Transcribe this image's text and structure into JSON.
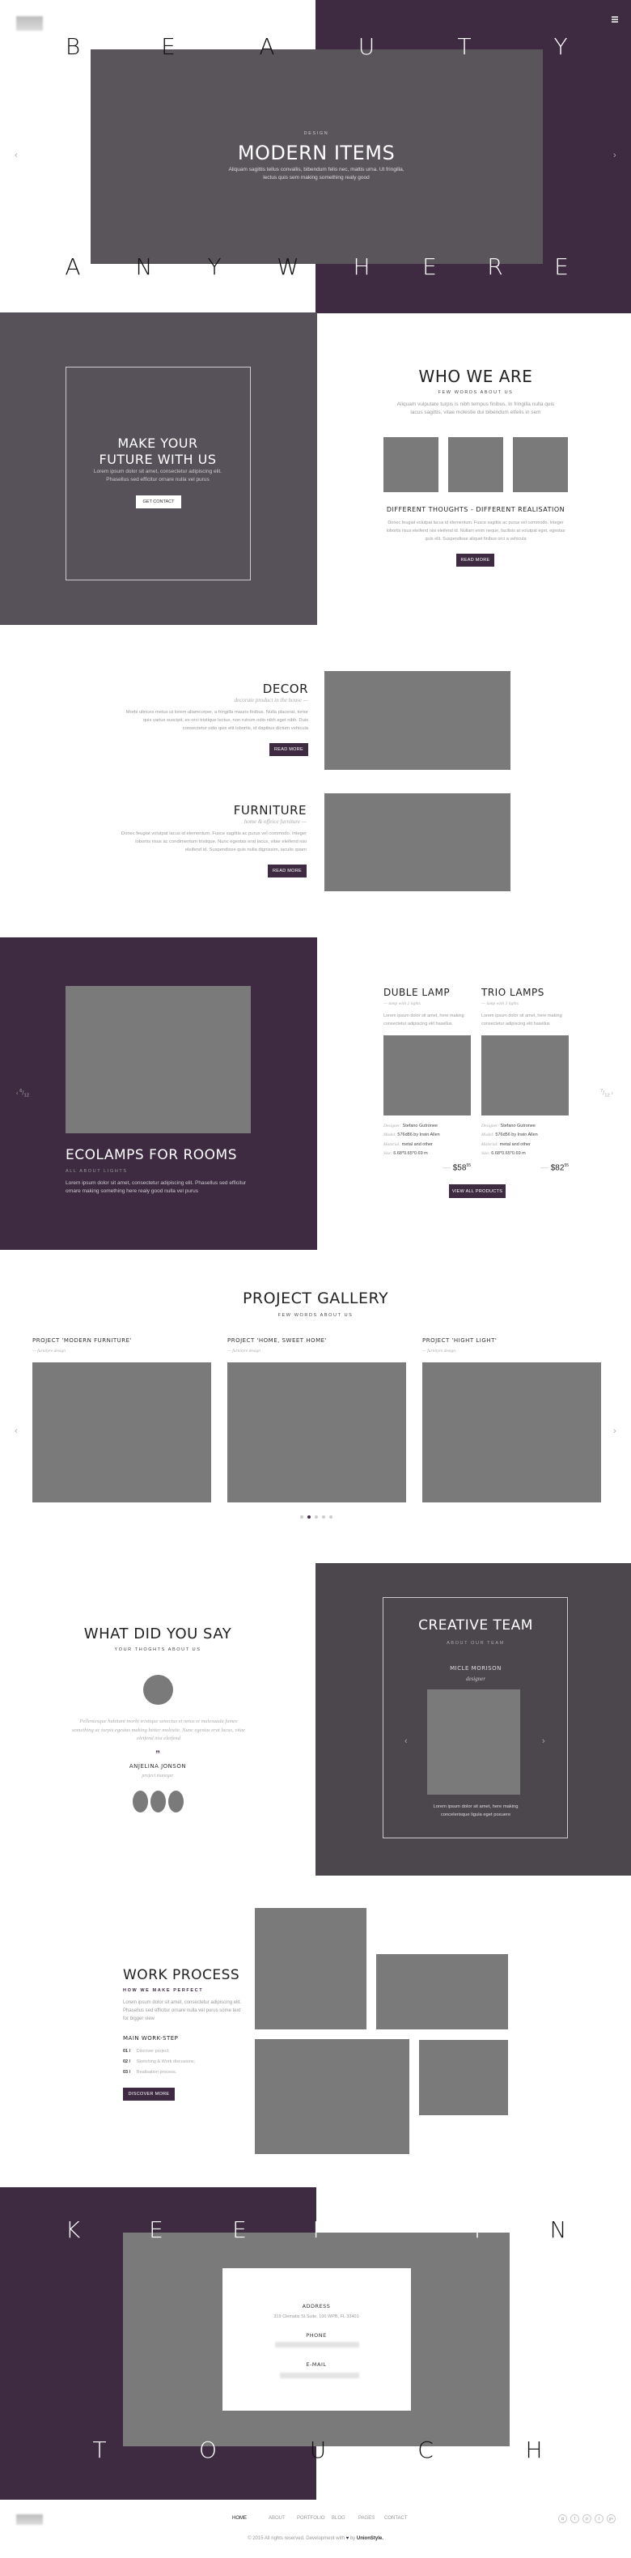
{
  "colors": {
    "accent": "#3e2b42",
    "panel": "#57525a",
    "placeholder": "#7a7a7a"
  },
  "header": {
    "logo": "logo",
    "menu_icon": "hamburger-icon"
  },
  "hero": {
    "top_letters": [
      "B",
      "E",
      "A",
      "U",
      "T",
      "Y"
    ],
    "bottom_letters": [
      "A",
      "N",
      "Y",
      "W",
      "H",
      "E",
      "R",
      "E"
    ],
    "kicker": "DESIGN",
    "title": "MODERN ITEMS",
    "text": "Aliquam sagittis tellus convallis, bibendum felis nec, mattis urna. Ut fringilla, lectus quis sem making something realy good"
  },
  "future": {
    "title": "MAKE YOUR FUTURE WITH US",
    "text": "Lorem ipsum dolor sit amet, consectetur adipiscing elit. Phasellus sed efficitur  ornare nulla vel purus",
    "button": "GET CONTACT"
  },
  "who": {
    "title": "WHO WE ARE",
    "subtitle": "FEW WORDS ABOUT US",
    "text": "Aliquam vulputate turpis is nibh tempus finibus. In fringilla nulla quis lacus sagittis, vitae molestie dui bibendum etfelis in sem",
    "heading": "DIFFERENT THOUGHTS - DIFFERENT REALISATION",
    "text2": "Donec feugiat volutpat lacus id elementum. Fusce sagittis ac purus vel commodo. Integer lobortis risus eleifend nisi eleifend id. Nullam enim neque, facilisis at volutpat eget, egestas quis elit. Suspendisse aliquet finibus orci a vehicula",
    "button": "READ MORE"
  },
  "features": [
    {
      "title": "DECOR",
      "subtitle": "decorate product in the house",
      "text": "Morbi ultrices metus ut lorem ullamcorper, a fringilla mauris finibus. Nulla placerat, tortor quis varius suscipit, ex orci tristique lectus, non rutrum odio nibh eget nibh. Duis consectetur odio quis elit lobortis, id dapibus dictum vehicula",
      "button": "READ MORE"
    },
    {
      "title": "FURNITURE",
      "subtitle": "home & offeice furniture",
      "text": "Donec feugiat volutpat lacus id elementum. Fusce sagittis ac purus vel commodo. Integer lobortis risus ac condimentum tristique. Nunc egestas erat lacus, vitae eleifend nisi eleifend id. Suspendisse quis nulla dignissim, iaculis quam",
      "button": "READ MORE"
    }
  ],
  "lamps": {
    "title": "ECOLAMPS FOR ROOMS",
    "subtitle": "ALL ABOUT LIGHTS",
    "text": "Lorem ipsum dolor sit amet, consectetur adipiscing elit. Phasellus sed efficitur ornare making something here realy good nulla vel purus",
    "prev_counter": {
      "num": "6",
      "den": "12"
    },
    "next_counter": {
      "num": "7",
      "den": "12"
    },
    "button": "VIEW ALL PRODUCTS",
    "products": [
      {
        "name": "DUBLE LAMP",
        "subtitle": "lamp with 2 lights",
        "text": "Lorem ipsum dolor sit amet, here making consectetur adipiscing elit hasellus",
        "designer_label": "Designer:",
        "designer": "Stefano Gutronee",
        "model_label": "Model:",
        "model": "576d86 by Irwin Allen",
        "material_label": "Material:",
        "material": "metal and other",
        "size_label": "Size:",
        "size": "6.68*0.65*0.69 m",
        "price": "$58",
        "cents": "55"
      },
      {
        "name": "TRIO LAMPS",
        "subtitle": "lamp with 3 lights",
        "text": "Lorem ipsum dolor sit amet, here making consectetur adipiscing elit hasellus",
        "designer_label": "Designer:",
        "designer": "Stefano Gutronee",
        "model_label": "Model:",
        "model": "576d56 by Irwin Allen",
        "material_label": "Material:",
        "material": "metal and other",
        "size_label": "Size:",
        "size": "6.68*0.65*0.69 m",
        "price": "$82",
        "cents": "55"
      }
    ]
  },
  "gallery": {
    "title": "PROJECT GALLERY",
    "subtitle": "FEW WORDS ABOUT US",
    "projects": [
      {
        "title": "PROJECT 'MODERN FURNITURE'",
        "subtitle": "furnityre design"
      },
      {
        "title": "PROJECT 'HOME, SWEET HOME'",
        "subtitle": "furnityre design"
      },
      {
        "title": "PROJECT 'HIGHT LIGHT'",
        "subtitle": "furnityre design"
      }
    ],
    "active_dot": 2,
    "dot_count": 5
  },
  "testimonial": {
    "title": "WHAT DID YOU SAY",
    "subtitle": "YOUR THOGHTS ABOUT US",
    "quote": "Pellentesque habitant morbi tristique senectus et netus et malesuada fames something ac turpis egestas making better molestie. Nunc egestas erat lacus, vitae eleifend nisi eleifend",
    "quote_mark": "”",
    "name": "ANJELINA JONSON",
    "role": "project maneger"
  },
  "team": {
    "title": "CREATIVE TEAM",
    "subtitle": "ABOUT OUR TEAM",
    "name": "MICLE MORISON",
    "role": "designer",
    "text": "Lorem ipsum dolor sit amet, here making concelerisque ligula eget posuere"
  },
  "work": {
    "title": "WORK PROCESS",
    "subtitle": "HOW WE MAKE PERFECT",
    "text": "Lorem ipsum dolor sit amet, consectetur adipiscing elit. Phasellus sed efficitur  ornare nulla vel purus some text for bigger view",
    "steps_title": "MAIN WORK-STEP",
    "steps": [
      {
        "num": "01 /",
        "label": "Discover project;"
      },
      {
        "num": "02 /",
        "label": "Sketching & Work discusions;"
      },
      {
        "num": "03 /",
        "label": "Realisation process."
      }
    ],
    "button": "DISCOVER MORE"
  },
  "contact": {
    "top_letters": [
      "K",
      "E",
      "E",
      "P",
      "I",
      "N"
    ],
    "bottom_letters": [
      "T",
      "O",
      "U",
      "C",
      "H"
    ],
    "address_label": "ADDRESS",
    "address": "319 Clematis St.Suite, 100 WPB, FL 33401",
    "phone_label": "PHONE",
    "email_label": "E-MAIL"
  },
  "footer": {
    "nav": [
      "HOME",
      "ABOUT",
      "PORTFOLIO",
      "BLOG",
      "PAGES",
      "CONTACT"
    ],
    "active": "HOME",
    "social": [
      "instagram",
      "facebook",
      "pinterest",
      "twitter",
      "google-plus"
    ],
    "copyright_pre": "© 2015 All rights reserved. Development with",
    "heart": "♥",
    "copyright_by": "by",
    "brand": "UnionStyle."
  }
}
